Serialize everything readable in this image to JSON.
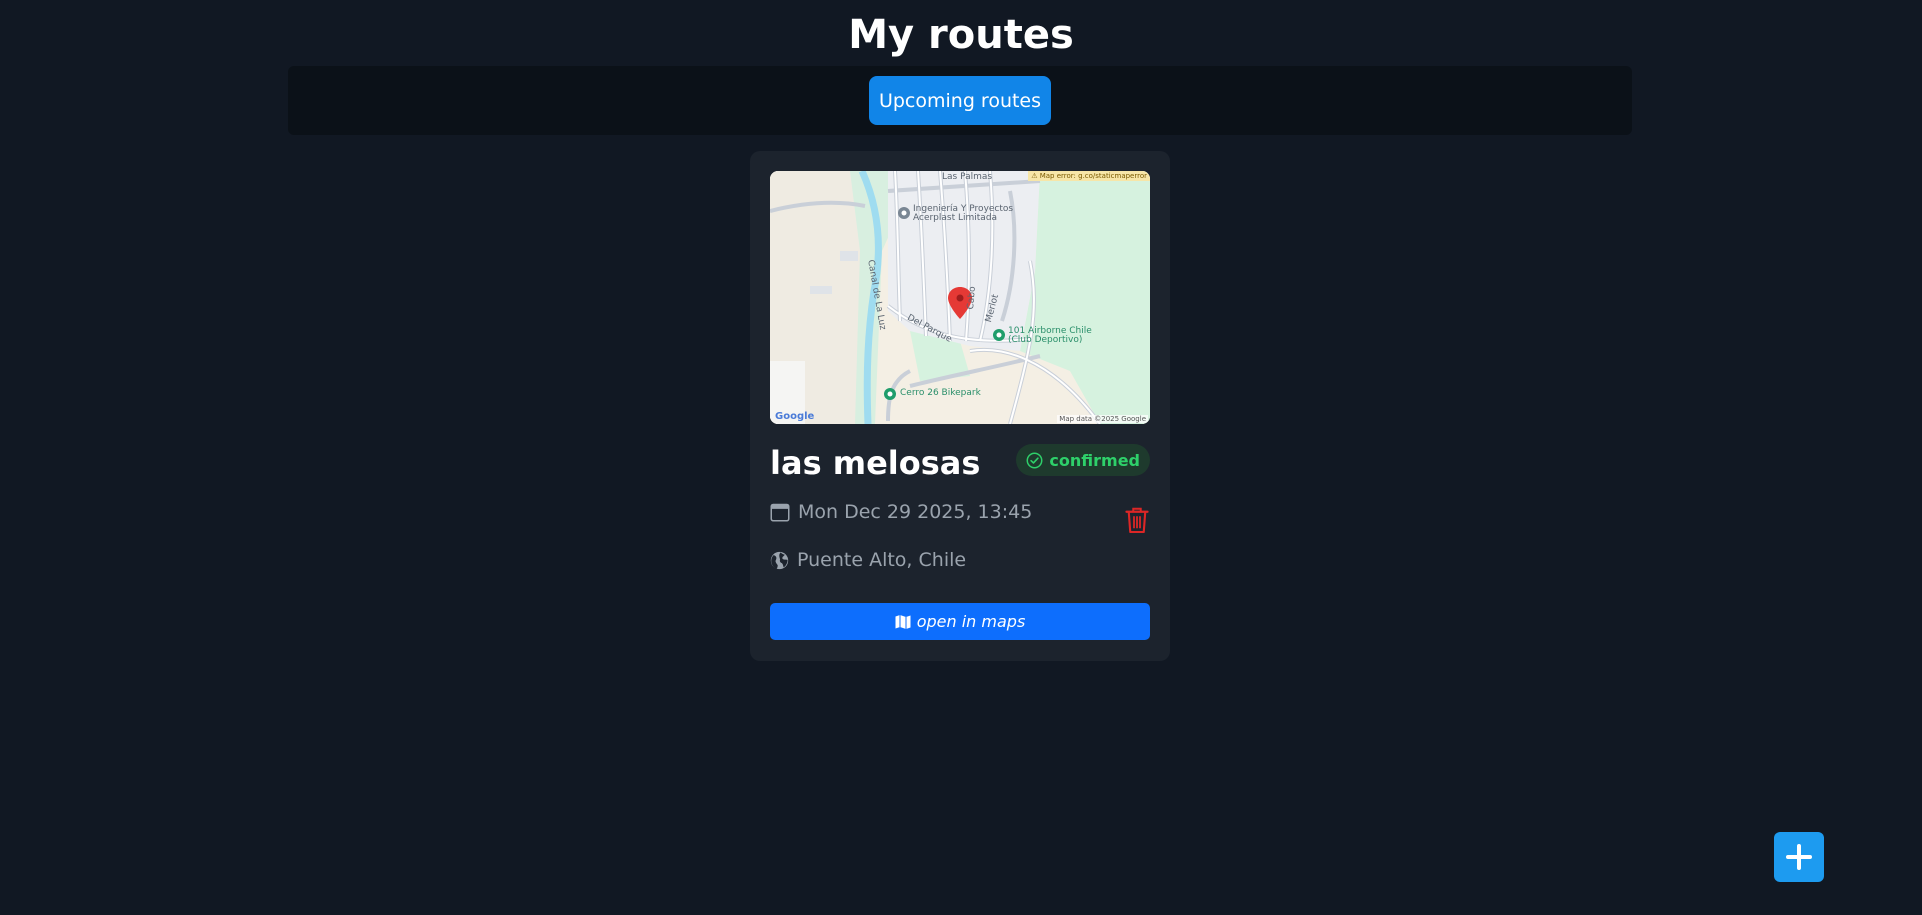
{
  "page": {
    "title": "My routes"
  },
  "tabs": [
    {
      "label": "Upcoming routes",
      "active": true
    }
  ],
  "route": {
    "name": "las melosas",
    "status": "confirmed",
    "datetime": "Mon Dec 29 2025, 13:45",
    "location": "Puente Alto, Chile",
    "open_maps_label": "open in maps",
    "map": {
      "error_text": "⚠ Map error: g.co/staticmaperror",
      "labels": {
        "las_palmas": "Las Palmas",
        "ingenieria_1": "Ingeniería Y Proyectos",
        "ingenieria_2": "Acerplast Limitada",
        "canal": "Canal de La Luz",
        "del_parque": "Del Parque",
        "cabo": "Cabo",
        "merlot": "Merlot",
        "airborne_1": "101 Airborne Chile",
        "airborne_2": "(Club Deportivo)",
        "bikepark": "Cerro 26 Bikepark"
      },
      "google_logo": "Google",
      "attribution": "Map data ©2025 Google"
    }
  },
  "icons": {
    "calendar": "calendar-icon",
    "globe": "globe-icon",
    "trash": "trash-icon",
    "check": "check-circle-icon",
    "map": "map-icon",
    "plus": "plus-icon"
  },
  "colors": {
    "background": "#111823",
    "card": "#1c232d",
    "primary": "#0d6efd",
    "tab_active": "#1185e8",
    "status_green": "#2ed06a",
    "danger": "#dc2626",
    "fab": "#1d9bf0"
  }
}
